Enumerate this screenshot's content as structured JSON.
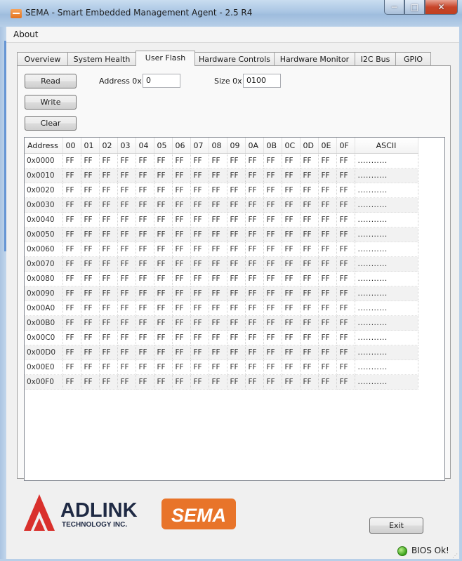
{
  "window": {
    "title": "SEMA - Smart Embedded Management Agent - 2.5 R4",
    "icon": "sema-app-icon",
    "controls": {
      "minimize": "−",
      "maximize": "□",
      "close": "✕"
    }
  },
  "menu": {
    "items": [
      "About"
    ]
  },
  "tabs": [
    "Overview",
    "System Health",
    "User Flash",
    "Hardware Controls",
    "Hardware Monitor",
    "I2C Bus",
    "GPIO"
  ],
  "active_tab": "User Flash",
  "toolbar": {
    "read_label": "Read",
    "write_label": "Write",
    "clear_label": "Clear"
  },
  "fields": {
    "address_label": "Address 0x",
    "address_value": "0",
    "size_label": "Size 0x",
    "size_value": "0100"
  },
  "grid": {
    "columns": [
      "Address",
      "00",
      "01",
      "02",
      "03",
      "04",
      "05",
      "06",
      "07",
      "08",
      "09",
      "0A",
      "0B",
      "0C",
      "0D",
      "0E",
      "0F",
      "ASCII"
    ],
    "rows": [
      {
        "address": "0x0000",
        "bytes": [
          "FF",
          "FF",
          "FF",
          "FF",
          "FF",
          "FF",
          "FF",
          "FF",
          "FF",
          "FF",
          "FF",
          "FF",
          "FF",
          "FF",
          "FF",
          "FF"
        ],
        "ascii": "..........."
      },
      {
        "address": "0x0010",
        "bytes": [
          "FF",
          "FF",
          "FF",
          "FF",
          "FF",
          "FF",
          "FF",
          "FF",
          "FF",
          "FF",
          "FF",
          "FF",
          "FF",
          "FF",
          "FF",
          "FF"
        ],
        "ascii": "..........."
      },
      {
        "address": "0x0020",
        "bytes": [
          "FF",
          "FF",
          "FF",
          "FF",
          "FF",
          "FF",
          "FF",
          "FF",
          "FF",
          "FF",
          "FF",
          "FF",
          "FF",
          "FF",
          "FF",
          "FF"
        ],
        "ascii": "..........."
      },
      {
        "address": "0x0030",
        "bytes": [
          "FF",
          "FF",
          "FF",
          "FF",
          "FF",
          "FF",
          "FF",
          "FF",
          "FF",
          "FF",
          "FF",
          "FF",
          "FF",
          "FF",
          "FF",
          "FF"
        ],
        "ascii": "..........."
      },
      {
        "address": "0x0040",
        "bytes": [
          "FF",
          "FF",
          "FF",
          "FF",
          "FF",
          "FF",
          "FF",
          "FF",
          "FF",
          "FF",
          "FF",
          "FF",
          "FF",
          "FF",
          "FF",
          "FF"
        ],
        "ascii": "..........."
      },
      {
        "address": "0x0050",
        "bytes": [
          "FF",
          "FF",
          "FF",
          "FF",
          "FF",
          "FF",
          "FF",
          "FF",
          "FF",
          "FF",
          "FF",
          "FF",
          "FF",
          "FF",
          "FF",
          "FF"
        ],
        "ascii": "..........."
      },
      {
        "address": "0x0060",
        "bytes": [
          "FF",
          "FF",
          "FF",
          "FF",
          "FF",
          "FF",
          "FF",
          "FF",
          "FF",
          "FF",
          "FF",
          "FF",
          "FF",
          "FF",
          "FF",
          "FF"
        ],
        "ascii": "..........."
      },
      {
        "address": "0x0070",
        "bytes": [
          "FF",
          "FF",
          "FF",
          "FF",
          "FF",
          "FF",
          "FF",
          "FF",
          "FF",
          "FF",
          "FF",
          "FF",
          "FF",
          "FF",
          "FF",
          "FF"
        ],
        "ascii": "..........."
      },
      {
        "address": "0x0080",
        "bytes": [
          "FF",
          "FF",
          "FF",
          "FF",
          "FF",
          "FF",
          "FF",
          "FF",
          "FF",
          "FF",
          "FF",
          "FF",
          "FF",
          "FF",
          "FF",
          "FF"
        ],
        "ascii": "..........."
      },
      {
        "address": "0x0090",
        "bytes": [
          "FF",
          "FF",
          "FF",
          "FF",
          "FF",
          "FF",
          "FF",
          "FF",
          "FF",
          "FF",
          "FF",
          "FF",
          "FF",
          "FF",
          "FF",
          "FF"
        ],
        "ascii": "..........."
      },
      {
        "address": "0x00A0",
        "bytes": [
          "FF",
          "FF",
          "FF",
          "FF",
          "FF",
          "FF",
          "FF",
          "FF",
          "FF",
          "FF",
          "FF",
          "FF",
          "FF",
          "FF",
          "FF",
          "FF"
        ],
        "ascii": "..........."
      },
      {
        "address": "0x00B0",
        "bytes": [
          "FF",
          "FF",
          "FF",
          "FF",
          "FF",
          "FF",
          "FF",
          "FF",
          "FF",
          "FF",
          "FF",
          "FF",
          "FF",
          "FF",
          "FF",
          "FF"
        ],
        "ascii": "..........."
      },
      {
        "address": "0x00C0",
        "bytes": [
          "FF",
          "FF",
          "FF",
          "FF",
          "FF",
          "FF",
          "FF",
          "FF",
          "FF",
          "FF",
          "FF",
          "FF",
          "FF",
          "FF",
          "FF",
          "FF"
        ],
        "ascii": "..........."
      },
      {
        "address": "0x00D0",
        "bytes": [
          "FF",
          "FF",
          "FF",
          "FF",
          "FF",
          "FF",
          "FF",
          "FF",
          "FF",
          "FF",
          "FF",
          "FF",
          "FF",
          "FF",
          "FF",
          "FF"
        ],
        "ascii": "..........."
      },
      {
        "address": "0x00E0",
        "bytes": [
          "FF",
          "FF",
          "FF",
          "FF",
          "FF",
          "FF",
          "FF",
          "FF",
          "FF",
          "FF",
          "FF",
          "FF",
          "FF",
          "FF",
          "FF",
          "FF"
        ],
        "ascii": "..........."
      },
      {
        "address": "0x00F0",
        "bytes": [
          "FF",
          "FF",
          "FF",
          "FF",
          "FF",
          "FF",
          "FF",
          "FF",
          "FF",
          "FF",
          "FF",
          "FF",
          "FF",
          "FF",
          "FF",
          "FF"
        ],
        "ascii": "..........."
      }
    ]
  },
  "branding": {
    "company": "ADLINK",
    "company_sub": "TECHNOLOGY INC.",
    "product": "SEMA",
    "company_color": "#1f2a44",
    "accent_color": "#e8742a",
    "logo_red": "#d9302c"
  },
  "footer": {
    "exit_label": "Exit",
    "status_text": "BIOS Ok!",
    "status_color": "#3aa21a"
  }
}
